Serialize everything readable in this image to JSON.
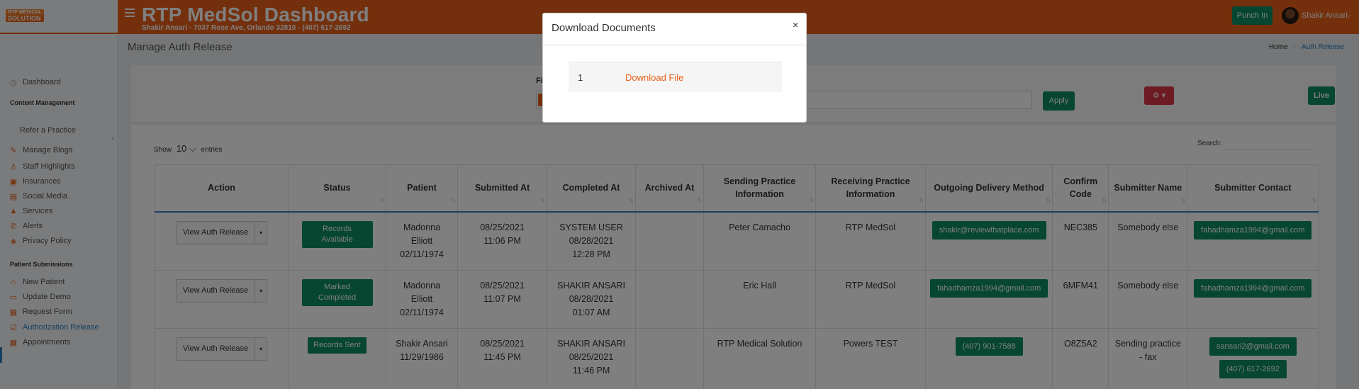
{
  "app": {
    "logo_line1": "RTP MEDICAL",
    "logo_line2": "SOLUTION",
    "title": "RTP MedSol Dashboard",
    "subtitle": "Shakir Ansari - 7037 Rose Ave, Orlando 32810 - (407) 617-2692",
    "punch_in_label": "Punch In",
    "user_name": "Shakir Ansari",
    "brand_color": "#e8611a",
    "green_color": "#0e8c63"
  },
  "sidebar": {
    "items": [
      {
        "label": "Dashboard",
        "icon": "dashboard-icon",
        "glyph": "◷"
      },
      {
        "label": "Content Management",
        "type": "heading"
      },
      {
        "label": "Refer a Practice",
        "icon": "none",
        "glyph": ""
      },
      {
        "label": "Manage Blogs",
        "icon": "blog-icon",
        "glyph": "✎"
      },
      {
        "label": "Staff Highlights",
        "icon": "user-badge-icon",
        "glyph": "♙"
      },
      {
        "label": "Insurances",
        "icon": "insurance-icon",
        "glyph": "▣"
      },
      {
        "label": "Social Media",
        "icon": "social-media-icon",
        "glyph": "▤"
      },
      {
        "label": "Services",
        "icon": "services-icon",
        "glyph": "▲"
      },
      {
        "label": "Alerts",
        "icon": "phone-alert-icon",
        "glyph": "✆"
      },
      {
        "label": "Privacy Policy",
        "icon": "shield-icon",
        "glyph": "◈"
      },
      {
        "label": "Patient Submissions",
        "type": "heading"
      },
      {
        "label": "New Patient",
        "icon": "home-icon",
        "glyph": "⌂"
      },
      {
        "label": "Update Demo",
        "icon": "id-card-icon",
        "glyph": "▭"
      },
      {
        "label": "Request Form",
        "icon": "form-icon",
        "glyph": "▦"
      },
      {
        "label": "Authorization Release",
        "icon": "checklist-icon",
        "glyph": "☑"
      },
      {
        "label": "Appointments",
        "icon": "calendar-icon",
        "glyph": "▦"
      }
    ]
  },
  "page": {
    "title": "Manage Auth Release",
    "breadcrumb_home": "Home",
    "breadcrumb_current": "Auth Release",
    "filter_label": "Fi",
    "apply_label": "Apply",
    "settings_label": "⚙ ▾",
    "live_label": "Live",
    "show_label": "Show",
    "entries_value": "10",
    "entries_label": "entries",
    "search_label": "Search:"
  },
  "table": {
    "headers": [
      "Action",
      "Status",
      "Patient",
      "Submitted At",
      "Completed At",
      "Archived At",
      "Sending Practice Information",
      "Receiving Practice Information",
      "Outgoing Delivery Method",
      "Confirm Code",
      "Submitter Name",
      "Submitter Contact"
    ],
    "action_label": "View Auth Release",
    "rows": [
      {
        "status": "Records Available",
        "patient": [
          "Madonna",
          "Elliott",
          "02/11/1974"
        ],
        "submitted": [
          "08/25/2021",
          "11:06 PM"
        ],
        "completed": [
          "SYSTEM USER",
          "08/28/2021",
          "12:28 PM"
        ],
        "archived": "",
        "sending": "Peter Camacho",
        "receiving": "RTP MedSol",
        "delivery": "shakir@reviewthatplace.com",
        "code": "NEC385",
        "submitter": "Somebody else",
        "contact": [
          "fahadhamza1994@gmail.com"
        ]
      },
      {
        "status": "Marked Completed",
        "patient": [
          "Madonna",
          "Elliott",
          "02/11/1974"
        ],
        "submitted": [
          "08/25/2021",
          "11:07 PM"
        ],
        "completed": [
          "SHAKIR ANSARI",
          "08/28/2021",
          "01:07 AM"
        ],
        "archived": "",
        "sending": "Eric Hall",
        "receiving": "RTP MedSol",
        "delivery": "fahadhamza1994@gmail.com",
        "code": "6MFM41",
        "submitter": "Somebody else",
        "contact": [
          "fahadhamza1994@gmail.com"
        ]
      },
      {
        "status": "Records Sent",
        "patient": [
          "Shakir Ansari",
          "11/29/1986"
        ],
        "submitted": [
          "08/25/2021",
          "11:45 PM"
        ],
        "completed": [
          "SHAKIR ANSARI",
          "08/25/2021",
          "11:46 PM"
        ],
        "archived": "",
        "sending": "RTP Medical Solution",
        "receiving": "Powers TEST",
        "delivery": "(407) 901-7588",
        "code": "O8Z5A2",
        "submitter": "Sending practice - fax",
        "contact": [
          "sansari2@gmail.com",
          "(407) 617-2692"
        ]
      }
    ]
  },
  "modal": {
    "title": "Download Documents",
    "close_label": "×",
    "row_number": "1",
    "link_label": "Download File"
  }
}
